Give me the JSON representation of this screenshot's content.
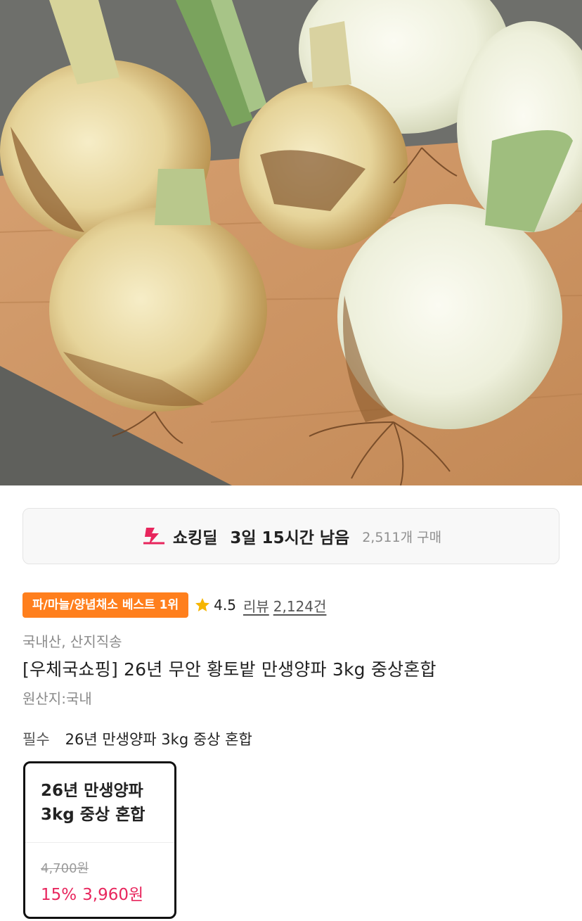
{
  "deal": {
    "title": "쇼킹딜",
    "time_left": "3일 15시간 남음",
    "purchase_count": "2,511개 구매",
    "accent_color": "#e8265d"
  },
  "badge": {
    "label": "파/마늘/양념채소 베스트 1위",
    "color": "#ff7f1d"
  },
  "rating": {
    "icon": "star-icon",
    "score": "4.5",
    "review_label": "리뷰",
    "review_count": "2,124건"
  },
  "product": {
    "tag": "국내산, 산지직송",
    "title": "[우체국쇼핑] 26년 무안 황토밭 만생양파 3kg 중상혼합",
    "origin": "원산지:국내"
  },
  "option": {
    "required_label": "필수",
    "name": "26년 만생양파 3kg 중상 혼합",
    "card": {
      "name_line1": "26년 만생양파",
      "name_line2": "3kg 중상 혼합",
      "original_price": "4,700원",
      "discount": "15%",
      "sale_price": "3,960원"
    }
  }
}
